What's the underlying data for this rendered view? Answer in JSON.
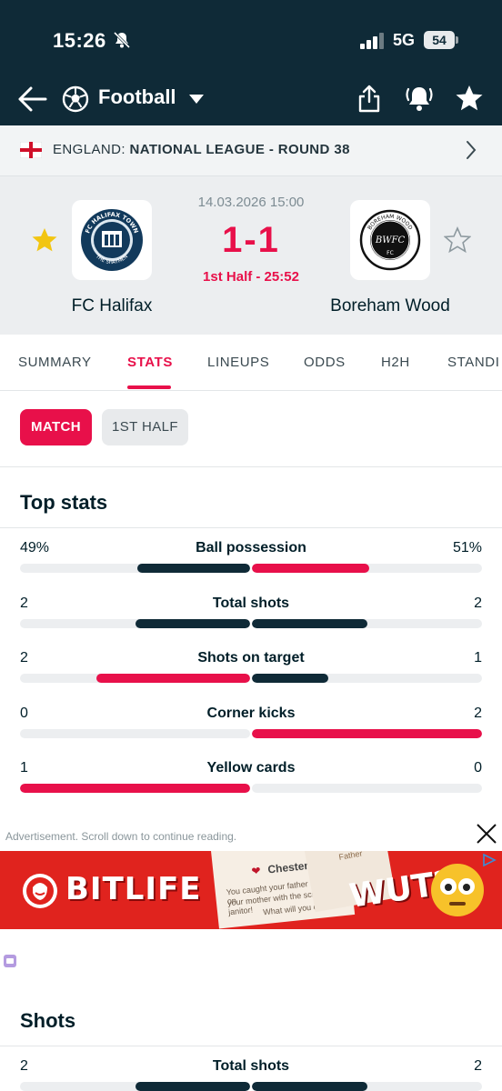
{
  "status_bar": {
    "time": "15:26",
    "network": "5G",
    "battery": "54"
  },
  "app_bar": {
    "sport": "Football"
  },
  "breadcrumb": {
    "country": "ENGLAND:",
    "competition": "NATIONAL LEAGUE - ROUND 38"
  },
  "match": {
    "datetime": "14.03.2026 15:00",
    "score": "1-1",
    "period": "1st Half - 25:52",
    "home": {
      "name": "FC Halifax",
      "logo_text": "FC HALIFAX TOWN",
      "logo_sub": "THE SHAYMEN",
      "favorite": true
    },
    "away": {
      "name": "Boreham Wood",
      "logo_text": "BOREHAM WOOD",
      "logo_mono": "BWFC",
      "logo_sub": "FC",
      "favorite": false
    }
  },
  "tabs": [
    "SUMMARY",
    "STATS",
    "LINEUPS",
    "ODDS",
    "H2H",
    "STANDI"
  ],
  "active_tab": "STATS",
  "filters": {
    "match": "MATCH",
    "first_half": "1ST HALF"
  },
  "top_stats": {
    "title": "Top stats",
    "rows": [
      {
        "label": "Ball possession",
        "home": "49%",
        "away": "51%",
        "home_fill": 0.49,
        "away_fill": 0.51,
        "home_color": "#0f2a37",
        "away_color": "#e8104a"
      },
      {
        "label": "Total shots",
        "home": "2",
        "away": "2",
        "home_fill": 0.5,
        "away_fill": 0.5,
        "home_color": "#0f2a37",
        "away_color": "#0f2a37"
      },
      {
        "label": "Shots on target",
        "home": "2",
        "away": "1",
        "home_fill": 0.667,
        "away_fill": 0.333,
        "home_color": "#e8104a",
        "away_color": "#0f2a37"
      },
      {
        "label": "Corner kicks",
        "home": "0",
        "away": "2",
        "home_fill": 0.0,
        "away_fill": 1.0,
        "home_color": "#0f2a37",
        "away_color": "#e8104a"
      },
      {
        "label": "Yellow cards",
        "home": "1",
        "away": "0",
        "home_fill": 1.0,
        "away_fill": 0.0,
        "home_color": "#e8104a",
        "away_color": "#0f2a37"
      }
    ]
  },
  "ad": {
    "note": "Advertisement. Scroll down to continue reading.",
    "brand": "BITLIFE",
    "card_name": "Chester",
    "card_lines": [
      "You caught your father cheating on",
      "your mother with the school janitor!",
      "What will you do?"
    ],
    "card2_title": "Father",
    "exclaim": "WUT?"
  },
  "shots": {
    "title": "Shots",
    "rows": [
      {
        "label": "Total shots",
        "home": "2",
        "away": "2",
        "home_fill": 0.5,
        "away_fill": 0.5,
        "home_color": "#0f2a37",
        "away_color": "#0f2a37"
      }
    ]
  },
  "colors": {
    "accent": "#e8104a",
    "dark": "#0f2a37",
    "star": "#f2c511"
  }
}
